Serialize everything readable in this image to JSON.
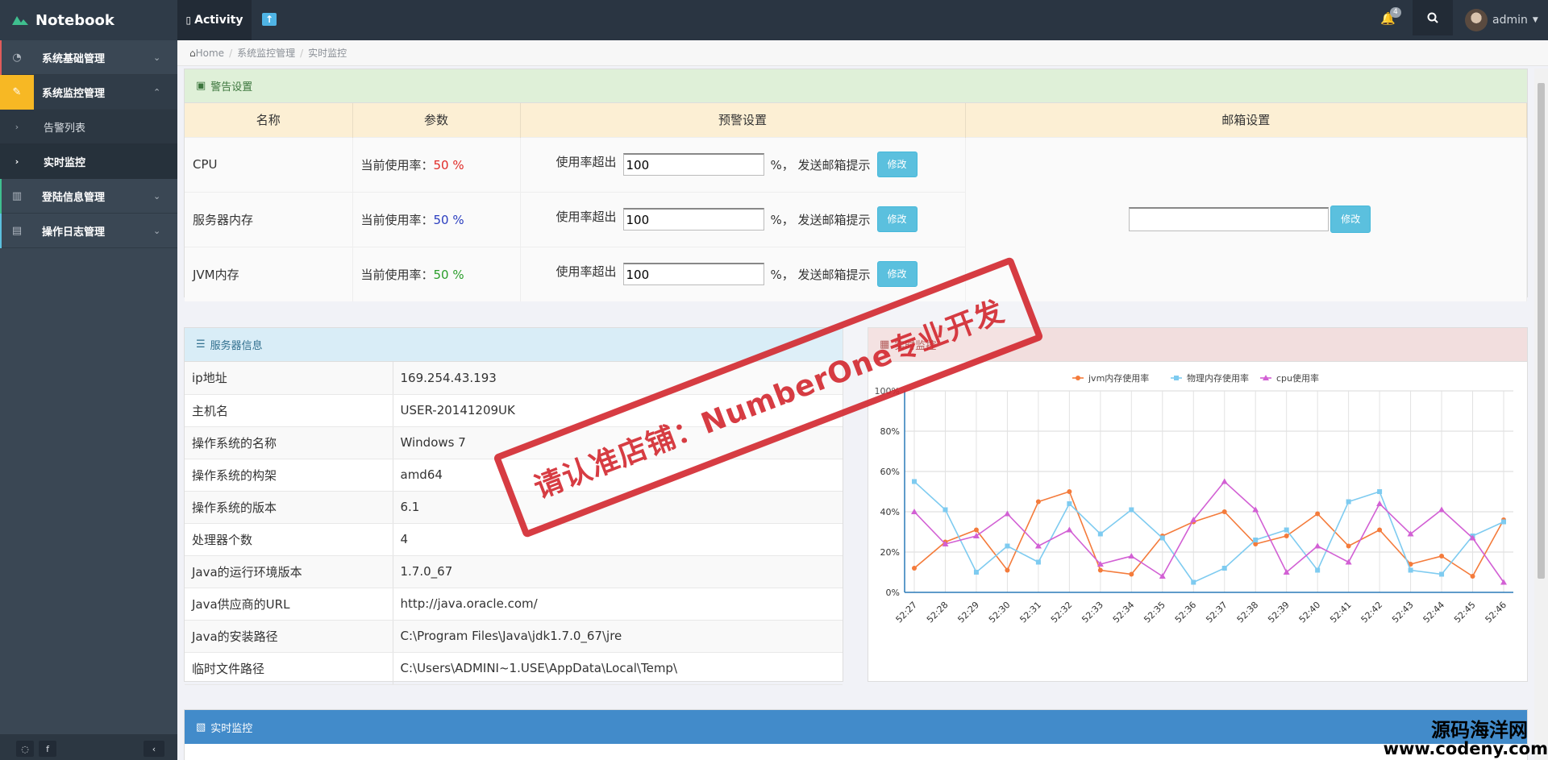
{
  "app": {
    "brand": "Notebook",
    "activity_tab": "Activity",
    "notifications": "4",
    "user": "admin"
  },
  "sidebar": {
    "items": [
      {
        "label": "系统基础管理"
      },
      {
        "label": "系统监控管理"
      },
      {
        "label": "告警列表"
      },
      {
        "label": "实时监控"
      },
      {
        "label": "登陆信息管理"
      },
      {
        "label": "操作日志管理"
      }
    ]
  },
  "breadcrumb": [
    "Home",
    "系统监控管理",
    "实时监控"
  ],
  "alert": {
    "title": "警告设置",
    "headers": [
      "名称",
      "参数",
      "预警设置",
      "邮箱设置"
    ],
    "rows": [
      {
        "name": "CPU",
        "usage_label": "当前使用率：",
        "usage": "50",
        "unit": "%",
        "threshold_label": "使用率超出",
        "threshold": "100",
        "suffix": "%，  发送邮箱提示",
        "button": "修改"
      },
      {
        "name": "服务器内存",
        "usage_label": "当前使用率：",
        "usage": "50",
        "unit": "%",
        "threshold_label": "使用率超出",
        "threshold": "100",
        "suffix": "%，  发送邮箱提示",
        "button": "修改"
      },
      {
        "name": "JVM内存",
        "usage_label": "当前使用率：",
        "usage": "50",
        "unit": "%",
        "threshold_label": "使用率超出",
        "threshold": "100",
        "suffix": "%，  发送邮箱提示",
        "button": "修改"
      }
    ],
    "mail_button": "修改",
    "mail_value": ""
  },
  "server": {
    "title": "服务器信息",
    "rows": [
      {
        "k": "ip地址",
        "v": "169.254.43.193"
      },
      {
        "k": "主机名",
        "v": "USER-20141209UK"
      },
      {
        "k": "操作系统的名称",
        "v": "Windows 7"
      },
      {
        "k": "操作系统的构架",
        "v": "amd64"
      },
      {
        "k": "操作系统的版本",
        "v": "6.1"
      },
      {
        "k": "处理器个数",
        "v": "4"
      },
      {
        "k": "Java的运行环境版本",
        "v": "1.7.0_67"
      },
      {
        "k": "Java供应商的URL",
        "v": "http://java.oracle.com/"
      },
      {
        "k": "Java的安装路径",
        "v": "C:\\Program Files\\Java\\jdk1.7.0_67\\jre"
      },
      {
        "k": "临时文件路径",
        "v": "C:\\Users\\ADMINI~1.USE\\AppData\\Local\\Temp\\"
      }
    ]
  },
  "monitor": {
    "title": "实时监控",
    "bottom_title": "实时监控"
  },
  "watermark": {
    "stamp": "请认准店铺：NumberOne专业开发",
    "site_cn": "源码海洋网",
    "site_url": "www.codeny.com"
  },
  "colors": {
    "jvm": "#f47b3b",
    "mem": "#7ecbf0",
    "cpu": "#d260d4",
    "accent": "#f7b824"
  },
  "chart_data": {
    "type": "line",
    "x": [
      "52:27",
      "52:28",
      "52:29",
      "52:30",
      "52:31",
      "52:32",
      "52:33",
      "52:34",
      "52:35",
      "52:36",
      "52:37",
      "52:38",
      "52:39",
      "52:40",
      "52:41",
      "52:42",
      "52:43",
      "52:44",
      "52:45",
      "52:46"
    ],
    "ylim": [
      0,
      100
    ],
    "yticks": [
      "0%",
      "20%",
      "40%",
      "60%",
      "80%",
      "100%"
    ],
    "legend_position": "top-center",
    "series": [
      {
        "name": "jvm内存使用率",
        "marker": "circle",
        "values": [
          12,
          25,
          31,
          11,
          45,
          50,
          11,
          9,
          28,
          35,
          40,
          24,
          28,
          39,
          23,
          31,
          14,
          18,
          8,
          36
        ]
      },
      {
        "name": "物理内存使用率",
        "marker": "square",
        "values": [
          55,
          41,
          10,
          23,
          15,
          44,
          29,
          41,
          27,
          5,
          12,
          26,
          31,
          11,
          45,
          50,
          11,
          9,
          28,
          35
        ]
      },
      {
        "name": "cpu使用率",
        "marker": "triangle",
        "values": [
          40,
          24,
          28,
          39,
          23,
          31,
          14,
          18,
          8,
          36,
          55,
          41,
          10,
          23,
          15,
          44,
          29,
          41,
          27,
          5
        ]
      }
    ]
  }
}
